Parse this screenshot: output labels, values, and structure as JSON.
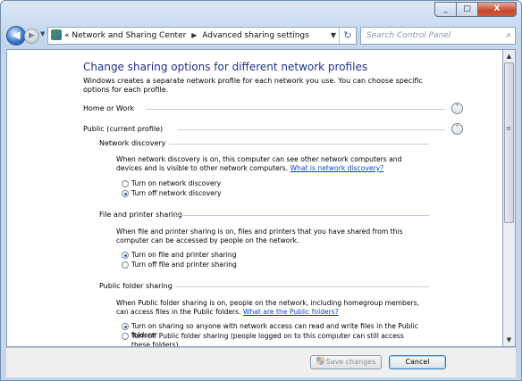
{
  "window": {
    "min_glyph": "_",
    "max_glyph": "□",
    "close_glyph": "X"
  },
  "nav": {
    "back_glyph": "◀",
    "forward_glyph": "▶",
    "history_glyph": "▼",
    "breadcrumb_prefix": "«",
    "crumb1": "Network and Sharing Center",
    "crumb_sep": "▶",
    "crumb2": "Advanced sharing settings",
    "refresh_glyph": "↻",
    "search_placeholder": "Search Control Panel"
  },
  "page": {
    "heading": "Change sharing options for different network profiles",
    "intro": "Windows creates a separate network profile for each network you use. You can choose specific options for each profile.",
    "profiles": [
      {
        "label": "Home or Work",
        "expanded": false
      },
      {
        "label": "Public (current profile)",
        "expanded": true
      }
    ],
    "sections": {
      "network_discovery": {
        "title": "Network discovery",
        "description": "When network discovery is on, this computer can see other network computers and devices and is visible to other network computers.",
        "link": "What is network discovery?",
        "options": [
          "Turn on network discovery",
          "Turn off network discovery"
        ],
        "selected": 1
      },
      "file_printer": {
        "title": "File and printer sharing",
        "description": "When file and printer sharing is on, files and printers that you have shared from this computer can be accessed by people on the network.",
        "options": [
          "Turn on file and printer sharing",
          "Turn off file and printer sharing"
        ],
        "selected": 0
      },
      "public_folder": {
        "title": "Public folder sharing",
        "description": "When Public folder sharing is on, people on the network, including homegroup members, can access files in the Public folders.",
        "link": "What are the Public folders?",
        "options": [
          "Turn on sharing so anyone with network access can read and write files in the Public folders",
          "Turn off Public folder sharing (people logged on to this computer can still access these folders)"
        ],
        "selected": 0
      }
    }
  },
  "footer": {
    "save_label": "Save changes",
    "cancel_label": "Cancel"
  },
  "icons": [
    "back-icon",
    "forward-icon",
    "control-panel-icon",
    "refresh-icon",
    "search-icon",
    "chevron-down-icon",
    "chevron-up-icon",
    "shield-icon"
  ]
}
